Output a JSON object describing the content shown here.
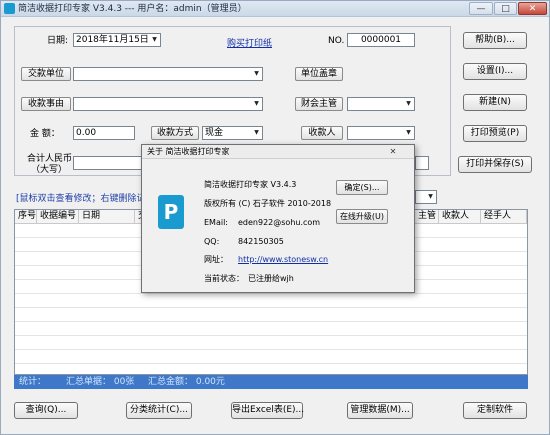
{
  "window": {
    "title": "简洁收据打印专家 V3.4.3 --- 用户名：admin（管理员）",
    "min_glyph": "—",
    "max_glyph": "□",
    "close_glyph": "✕"
  },
  "form": {
    "date_label": "日期:",
    "date_value": "2018年11月15日",
    "buy_paper_link": "购买打印纸",
    "no_label": "NO.",
    "no_value": "0000001",
    "payer_button": "交款单位",
    "payer_value": "",
    "reason_button": "收款事由",
    "reason_value": "",
    "amount_label": "金    额：",
    "amount_value": "0.00",
    "method_button": "收款方式",
    "method_value": "现金",
    "rmb_label_line1": "合计人民币",
    "rmb_label_line2": "（大写）",
    "rmb_value": "",
    "seal_button": "单位盖章",
    "accounting_button": "财会主管",
    "accounting_value": "",
    "receiver_button": "收款人",
    "receiver_value": "",
    "handler_value": "",
    "hint_text": "[鼠标双击查看修改；右键删除记录，"
  },
  "side_buttons": [
    "帮助(B)...",
    "设置(I)...",
    "新建(N)",
    "打印预览(P)",
    "打印并保存(S)"
  ],
  "grid": {
    "columns": [
      "序号",
      "收据编号",
      "日期",
      "交",
      "主管",
      "收款人",
      "经手人"
    ],
    "row_count_visible": 11
  },
  "status": {
    "stats_label": "统计：",
    "count_text": "汇总单据：  00张",
    "amount_text": "汇总金额：  0.00元"
  },
  "bottom_buttons": [
    "查询(Q)...",
    "分类统计(C)...",
    "导出Excel表(E)...",
    "管理数据(M)...",
    "定制软件"
  ],
  "about_dialog": {
    "title": "关于 简洁收据打印专家",
    "close_glyph": "✕",
    "logo_letter": "P",
    "app_name": "简洁收据打印专家 V3.4.3",
    "copyright": "版权所有 (C) 石子软件 2010-2018",
    "email_label": "EMail:",
    "email": "eden922@sohu.com",
    "qq_label": "QQ:",
    "qq": "842150305",
    "site_label": "网址：",
    "site": "http://www.stonesw.cn",
    "status_label": "当前状态：",
    "status_value": "已注册给wjh",
    "ok_button": "确定(S)...",
    "upgrade_button": "在线升级(U)"
  },
  "colors": {
    "accent_blue": "#3f78c8",
    "link_blue": "#0f2ea8",
    "logo_teal": "#1a9bd0"
  }
}
